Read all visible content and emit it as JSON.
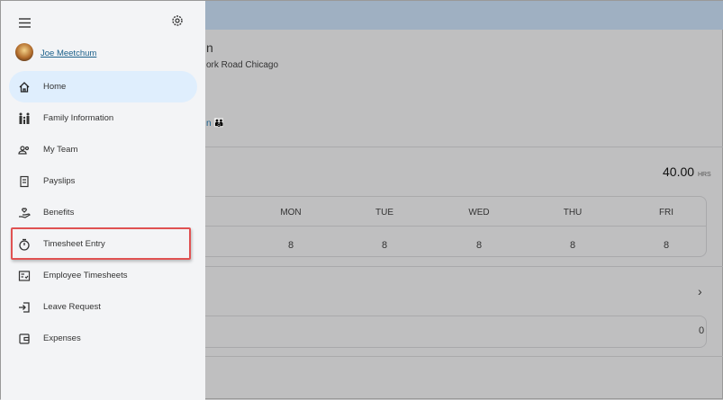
{
  "user": {
    "name": "Joe Meetchum"
  },
  "background": {
    "title_fragment": "n",
    "address_fragment": "ork Road Chicago",
    "link_fragment": "n",
    "total_hours": "40.00",
    "hours_unit": "HRS",
    "days": [
      "MON",
      "TUE",
      "WED",
      "THU",
      "FRI"
    ],
    "hours": [
      "8",
      "8",
      "8",
      "8",
      "8"
    ],
    "count": "0"
  },
  "nav": {
    "items": [
      {
        "label": "Home",
        "icon": "home-icon"
      },
      {
        "label": "Family Information",
        "icon": "family-icon"
      },
      {
        "label": "My Team",
        "icon": "team-icon"
      },
      {
        "label": "Payslips",
        "icon": "payslip-icon"
      },
      {
        "label": "Benefits",
        "icon": "benefits-icon"
      },
      {
        "label": "Timesheet Entry",
        "icon": "stopwatch-icon"
      },
      {
        "label": "Employee Timesheets",
        "icon": "timesheet-list-icon"
      },
      {
        "label": "Leave Request",
        "icon": "leave-icon"
      },
      {
        "label": "Expenses",
        "icon": "wallet-icon"
      }
    ],
    "active": "Home",
    "highlighted": "Timesheet Entry"
  },
  "colors": {
    "accent": "#dfeefd",
    "highlight": "#e05252",
    "link": "#1a5f8a"
  }
}
